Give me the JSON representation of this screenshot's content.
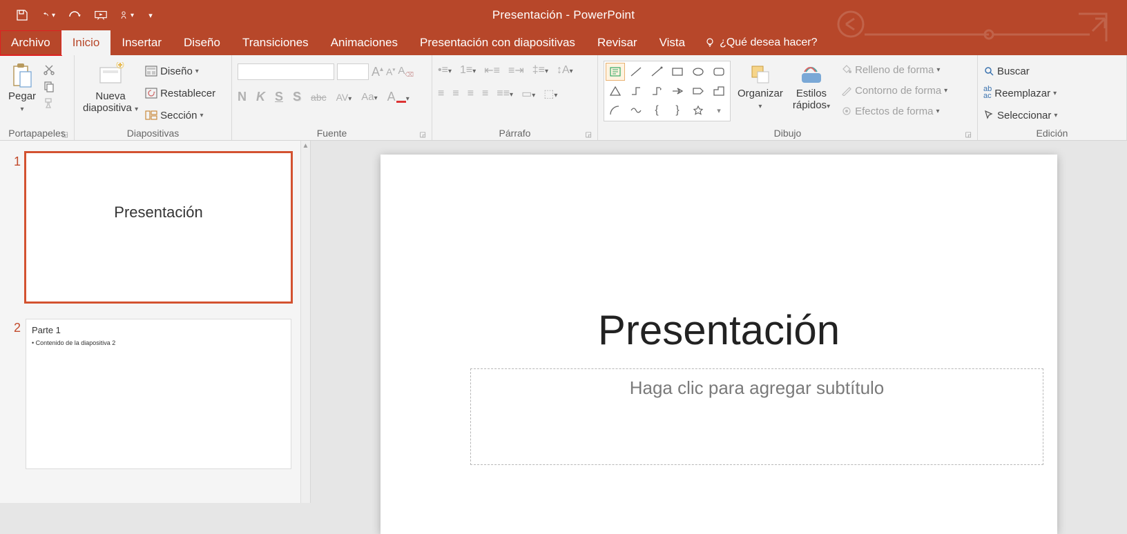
{
  "app_title": "Presentación - PowerPoint",
  "qat": {
    "save": "save",
    "undo": "undo",
    "redo": "redo",
    "slideshow": "slideshow",
    "touch": "touch"
  },
  "tabs": {
    "file": "Archivo",
    "home": "Inicio",
    "insert": "Insertar",
    "design": "Diseño",
    "transitions": "Transiciones",
    "animations": "Animaciones",
    "slideshow": "Presentación con diapositivas",
    "review": "Revisar",
    "view": "Vista",
    "tellme": "¿Qué desea hacer?"
  },
  "ribbon": {
    "clipboard": {
      "paste": "Pegar",
      "label": "Portapapeles"
    },
    "slides": {
      "new_slide": "Nueva\ndiapositiva",
      "layout": "Diseño",
      "reset": "Restablecer",
      "section": "Sección",
      "label": "Diapositivas"
    },
    "font": {
      "bold": "N",
      "italic": "K",
      "underline": "S",
      "shadow": "S",
      "strike": "abc",
      "spacing": "AV",
      "case": "Aa",
      "color": "A",
      "label": "Fuente"
    },
    "para": {
      "label": "Párrafo"
    },
    "draw": {
      "arrange": "Organizar",
      "styles": "Estilos\nrápidos",
      "fill": "Relleno de forma",
      "outline": "Contorno de forma",
      "effects": "Efectos de forma",
      "label": "Dibujo"
    },
    "edit": {
      "find": "Buscar",
      "replace": "Reemplazar",
      "select": "Seleccionar",
      "label": "Edición"
    }
  },
  "thumbs": [
    {
      "num": "1",
      "title": "Presentación"
    },
    {
      "num": "2",
      "heading": "Parte 1",
      "bullet": "• Contenido de la diapositiva 2"
    }
  ],
  "slide": {
    "title": "Presentación",
    "subtitle_placeholder": "Haga clic para agregar subtítulo"
  }
}
